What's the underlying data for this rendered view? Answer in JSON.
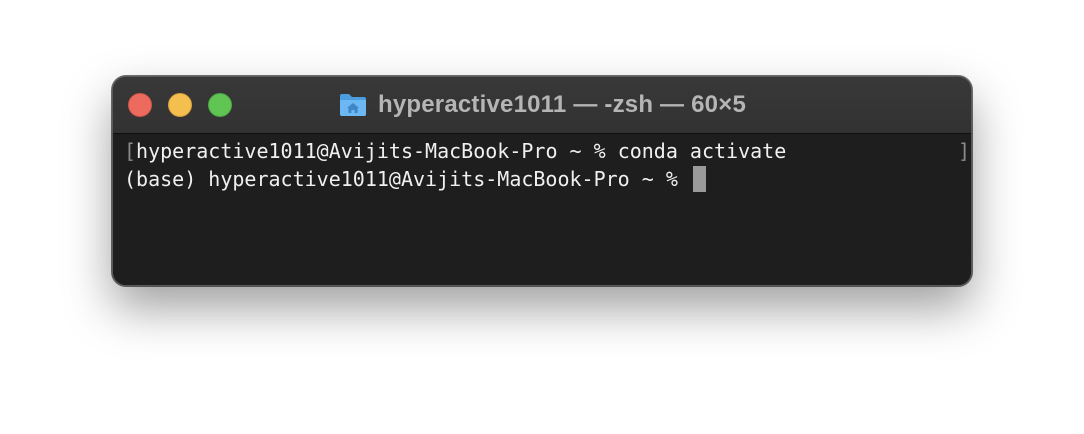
{
  "window": {
    "title": "hyperactive1011 — -zsh — 60×5",
    "title_icon": "home-folder-icon"
  },
  "terminal": {
    "line1": {
      "left_mark": "[",
      "text": "hyperactive1011@Avijits-MacBook-Pro ~ % conda activate",
      "right_mark": "]"
    },
    "line2": {
      "text": "(base) hyperactive1011@Avijits-MacBook-Pro ~ % "
    }
  },
  "colors": {
    "background": "#1e1e1e",
    "titlebar": "#353535",
    "text": "#f0f0f0",
    "close": "#ed6a5e",
    "minimize": "#f5bf4f",
    "zoom": "#61c554",
    "cursor": "#9a9a9a"
  }
}
